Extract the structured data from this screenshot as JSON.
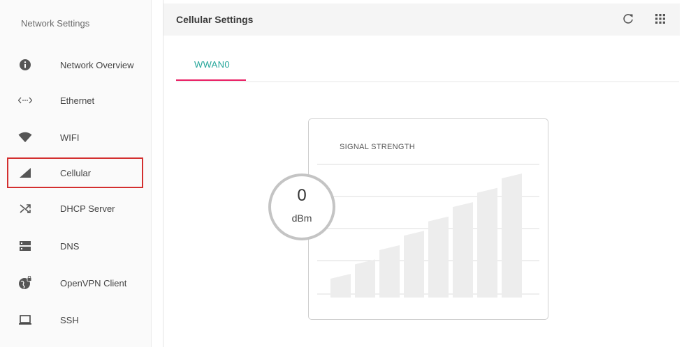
{
  "sidebar": {
    "title": "Network Settings",
    "items": [
      {
        "label": "Network Overview",
        "icon": "info-icon"
      },
      {
        "label": "Ethernet",
        "icon": "ethernet-icon"
      },
      {
        "label": "WIFI",
        "icon": "wifi-icon"
      },
      {
        "label": "Cellular",
        "icon": "cellular-icon",
        "selected": true
      },
      {
        "label": "DHCP Server",
        "icon": "shuffle-icon"
      },
      {
        "label": "DNS",
        "icon": "dns-icon"
      },
      {
        "label": "OpenVPN Client",
        "icon": "vpn-globe-lock-icon"
      },
      {
        "label": "SSH",
        "icon": "laptop-icon"
      }
    ]
  },
  "header": {
    "title": "Cellular Settings",
    "refresh_icon": "refresh-icon",
    "apps_icon": "grid-icon"
  },
  "tabs": [
    {
      "label": "WWAN0",
      "active": true
    }
  ],
  "signal": {
    "title": "SIGNAL STRENGTH",
    "value": "0",
    "unit": "dBm",
    "active_bars": 0,
    "total_bars": 8
  },
  "colors": {
    "accent_tab_text": "#26a69a",
    "accent_underline": "#e91e63",
    "selection_outline": "#d32f2f",
    "bar_fill": "#ededed"
  }
}
